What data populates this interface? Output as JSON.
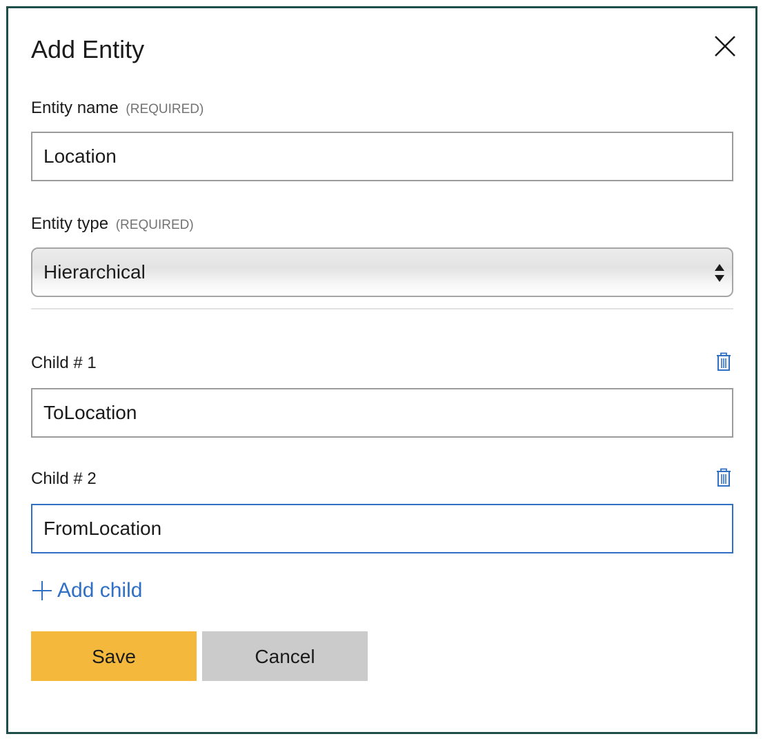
{
  "dialog": {
    "title": "Add Entity",
    "close_icon": "close-icon"
  },
  "entity_name": {
    "label": "Entity name",
    "required_tag": "(REQUIRED)",
    "value": "Location"
  },
  "entity_type": {
    "label": "Entity type",
    "required_tag": "(REQUIRED)",
    "selected": "Hierarchical",
    "icon": "select-arrows-icon"
  },
  "children": [
    {
      "label": "Child # 1",
      "value": "ToLocation",
      "delete_icon": "trash-icon"
    },
    {
      "label": "Child # 2",
      "value": "FromLocation",
      "delete_icon": "trash-icon"
    }
  ],
  "add_child": {
    "label": "Add child",
    "icon": "plus-icon"
  },
  "actions": {
    "save_label": "Save",
    "cancel_label": "Cancel"
  },
  "colors": {
    "border": "#1f4e4a",
    "accent": "#2f6fc4",
    "save": "#f4b93c",
    "cancel": "#cbcbcb"
  }
}
